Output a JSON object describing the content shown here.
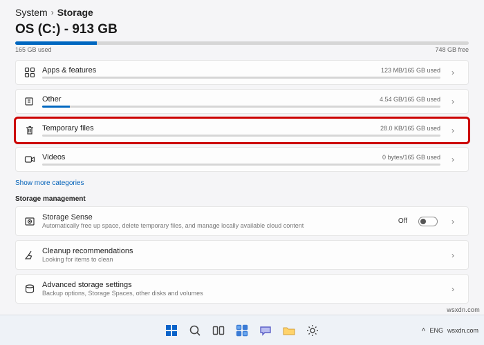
{
  "breadcrumb": {
    "parent": "System",
    "current": "Storage"
  },
  "drive": {
    "title": "OS (C:) - 913 GB",
    "used_label": "165 GB used",
    "free_label": "748 GB free",
    "fill_percent": 18
  },
  "categories": [
    {
      "name": "Apps & features",
      "usage": "123 MB/165 GB used",
      "fill_percent": 0,
      "highlight": false,
      "icon": "apps"
    },
    {
      "name": "Other",
      "usage": "4.54 GB/165 GB used",
      "fill_percent": 7,
      "highlight": false,
      "icon": "other"
    },
    {
      "name": "Temporary files",
      "usage": "28.0 KB/165 GB used",
      "fill_percent": 0,
      "highlight": true,
      "icon": "trash"
    },
    {
      "name": "Videos",
      "usage": "0 bytes/165 GB used",
      "fill_percent": 0,
      "highlight": false,
      "icon": "video"
    }
  ],
  "show_more": "Show more categories",
  "storage_mgmt_header": "Storage management",
  "mgmt": [
    {
      "title": "Storage Sense",
      "sub": "Automatically free up space, delete temporary files, and manage locally available cloud content",
      "toggle": {
        "label": "Off",
        "on": false
      },
      "icon": "disk"
    },
    {
      "title": "Cleanup recommendations",
      "sub": "Looking for items to clean",
      "icon": "broom"
    },
    {
      "title": "Advanced storage settings",
      "sub": "Backup options, Storage Spaces, other disks and volumes",
      "icon": "drive"
    }
  ],
  "taskbar": {
    "tray": {
      "lang": "ENG",
      "more": "wsxdn.com"
    }
  },
  "watermark": "wsxdn.com"
}
